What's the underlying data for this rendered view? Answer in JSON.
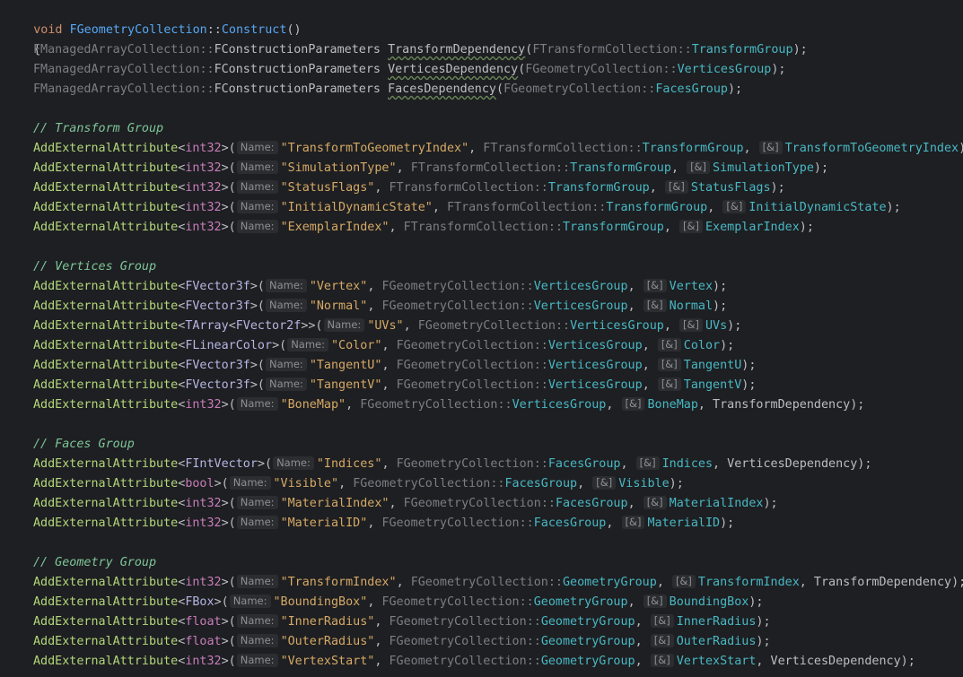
{
  "header": {
    "kw_void": "void",
    "class_name": "FGeometryCollection",
    "sep": "::",
    "method": "Construct",
    "parens": "()"
  },
  "open_brace": "{",
  "deps": [
    {
      "prefix": "FManagedArrayCollection",
      "type": "FConstructionParameters",
      "name": "TransformDependency",
      "arg_class": "FTransformCollection",
      "arg_member": "TransformGroup"
    },
    {
      "prefix": "FManagedArrayCollection",
      "type": "FConstructionParameters",
      "name": "VerticesDependency",
      "arg_class": "FGeometryCollection",
      "arg_member": "VerticesGroup"
    },
    {
      "prefix": "FManagedArrayCollection",
      "type": "FConstructionParameters",
      "name": "FacesDependency",
      "arg_class": "FGeometryCollection",
      "arg_member": "FacesGroup"
    }
  ],
  "comments": {
    "transform": "// Transform Group",
    "vertices": "// Vertices Group",
    "faces": "// Faces Group",
    "geometry": "// Geometry Group"
  },
  "hints": {
    "name": "Name:",
    "ref": "[&]"
  },
  "fn_name": "AddExternalAttribute",
  "attrs": [
    {
      "tmpl": "int32",
      "str": "\"TransformToGeometryIndex\"",
      "cls": "FTransformCollection",
      "grp": "TransformGroup",
      "ref": "TransformToGeometryIndex",
      "extra": ""
    },
    {
      "tmpl": "int32",
      "str": "\"SimulationType\"",
      "cls": "FTransformCollection",
      "grp": "TransformGroup",
      "ref": "SimulationType",
      "extra": ""
    },
    {
      "tmpl": "int32",
      "str": "\"StatusFlags\"",
      "cls": "FTransformCollection",
      "grp": "TransformGroup",
      "ref": "StatusFlags",
      "extra": ""
    },
    {
      "tmpl": "int32",
      "str": "\"InitialDynamicState\"",
      "cls": "FTransformCollection",
      "grp": "TransformGroup",
      "ref": "InitialDynamicState",
      "extra": ""
    },
    {
      "tmpl": "int32",
      "str": "\"ExemplarIndex\"",
      "cls": "FTransformCollection",
      "grp": "TransformGroup",
      "ref": "ExemplarIndex",
      "extra": ""
    },
    {
      "tmpl": "FVector3f",
      "str": "\"Vertex\"",
      "cls": "FGeometryCollection",
      "grp": "VerticesGroup",
      "ref": "Vertex",
      "extra": ""
    },
    {
      "tmpl": "FVector3f",
      "str": "\"Normal\"",
      "cls": "FGeometryCollection",
      "grp": "VerticesGroup",
      "ref": "Normal",
      "extra": ""
    },
    {
      "tmpl": "TArray<FVector2f>",
      "str": "\"UVs\"",
      "cls": "FGeometryCollection",
      "grp": "VerticesGroup",
      "ref": "UVs",
      "extra": ""
    },
    {
      "tmpl": "FLinearColor",
      "str": "\"Color\"",
      "cls": "FGeometryCollection",
      "grp": "VerticesGroup",
      "ref": "Color",
      "extra": ""
    },
    {
      "tmpl": "FVector3f",
      "str": "\"TangentU\"",
      "cls": "FGeometryCollection",
      "grp": "VerticesGroup",
      "ref": "TangentU",
      "extra": ""
    },
    {
      "tmpl": "FVector3f",
      "str": "\"TangentV\"",
      "cls": "FGeometryCollection",
      "grp": "VerticesGroup",
      "ref": "TangentV",
      "extra": ""
    },
    {
      "tmpl": "int32",
      "str": "\"BoneMap\"",
      "cls": "FGeometryCollection",
      "grp": "VerticesGroup",
      "ref": "BoneMap",
      "extra": "TransformDependency"
    },
    {
      "tmpl": "FIntVector",
      "str": "\"Indices\"",
      "cls": "FGeometryCollection",
      "grp": "FacesGroup",
      "ref": "Indices",
      "extra": "VerticesDependency"
    },
    {
      "tmpl": "bool",
      "str": "\"Visible\"",
      "cls": "FGeometryCollection",
      "grp": "FacesGroup",
      "ref": "Visible",
      "extra": ""
    },
    {
      "tmpl": "int32",
      "str": "\"MaterialIndex\"",
      "cls": "FGeometryCollection",
      "grp": "FacesGroup",
      "ref": "MaterialIndex",
      "extra": ""
    },
    {
      "tmpl": "int32",
      "str": "\"MaterialID\"",
      "cls": "FGeometryCollection",
      "grp": "FacesGroup",
      "ref": "MaterialID",
      "extra": ""
    },
    {
      "tmpl": "int32",
      "str": "\"TransformIndex\"",
      "cls": "FGeometryCollection",
      "grp": "GeometryGroup",
      "ref": "TransformIndex",
      "extra": "TransformDependency"
    },
    {
      "tmpl": "FBox",
      "str": "\"BoundingBox\"",
      "cls": "FGeometryCollection",
      "grp": "GeometryGroup",
      "ref": "BoundingBox",
      "extra": ""
    },
    {
      "tmpl": "float",
      "str": "\"InnerRadius\"",
      "cls": "FGeometryCollection",
      "grp": "GeometryGroup",
      "ref": "InnerRadius",
      "extra": ""
    },
    {
      "tmpl": "float",
      "str": "\"OuterRadius\"",
      "cls": "FGeometryCollection",
      "grp": "GeometryGroup",
      "ref": "OuterRadius",
      "extra": ""
    },
    {
      "tmpl": "int32",
      "str": "\"VertexStart\"",
      "cls": "FGeometryCollection",
      "grp": "GeometryGroup",
      "ref": "VertexStart",
      "extra": "VerticesDependency"
    }
  ]
}
